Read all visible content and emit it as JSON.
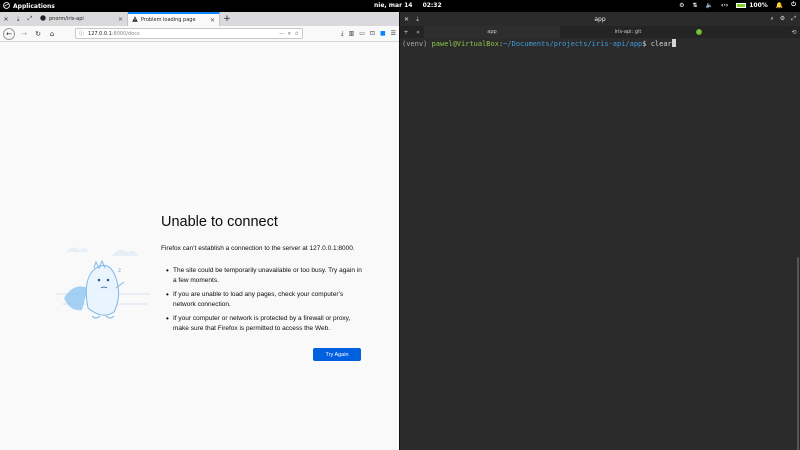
{
  "top_panel": {
    "applications_label": "Applications",
    "date": "nie, mar 14",
    "time": "02:32",
    "battery": "100%"
  },
  "firefox": {
    "tabs": [
      {
        "title": "pnorm/iris-api",
        "active": false
      },
      {
        "title": "Problem loading page",
        "active": true
      }
    ],
    "url_host": "127.0.0.1",
    "url_path": ":8000/docs",
    "error": {
      "title": "Unable to connect",
      "description": "Firefox can’t establish a connection to the server at 127.0.0.1:8000.",
      "bullets": [
        "The site could be temporarily unavailable or too busy. Try again in a few moments.",
        "If you are unable to load any pages, check your computer’s network connection.",
        "If your computer or network is protected by a firewall or proxy, make sure that Firefox is permitted to access the Web."
      ],
      "button": "Try Again"
    }
  },
  "terminal": {
    "window_title": "app",
    "tabs": [
      {
        "title": "app",
        "active": true
      },
      {
        "title": "iris-api: git",
        "active": false
      }
    ],
    "prompt": {
      "venv": "(venv)",
      "user_host": "pawel@VirtualBox",
      "sep": ":",
      "path": "~/Documents/projects/iris-api/app",
      "symbol": "$",
      "command": "clear"
    }
  },
  "colors": {
    "accent_blue": "#0060df",
    "tab_indicator": "#0a84ff",
    "terminal_bg": "#2b2b2b",
    "prompt_user": "#8bc34a",
    "prompt_path": "#3f9bd8"
  }
}
